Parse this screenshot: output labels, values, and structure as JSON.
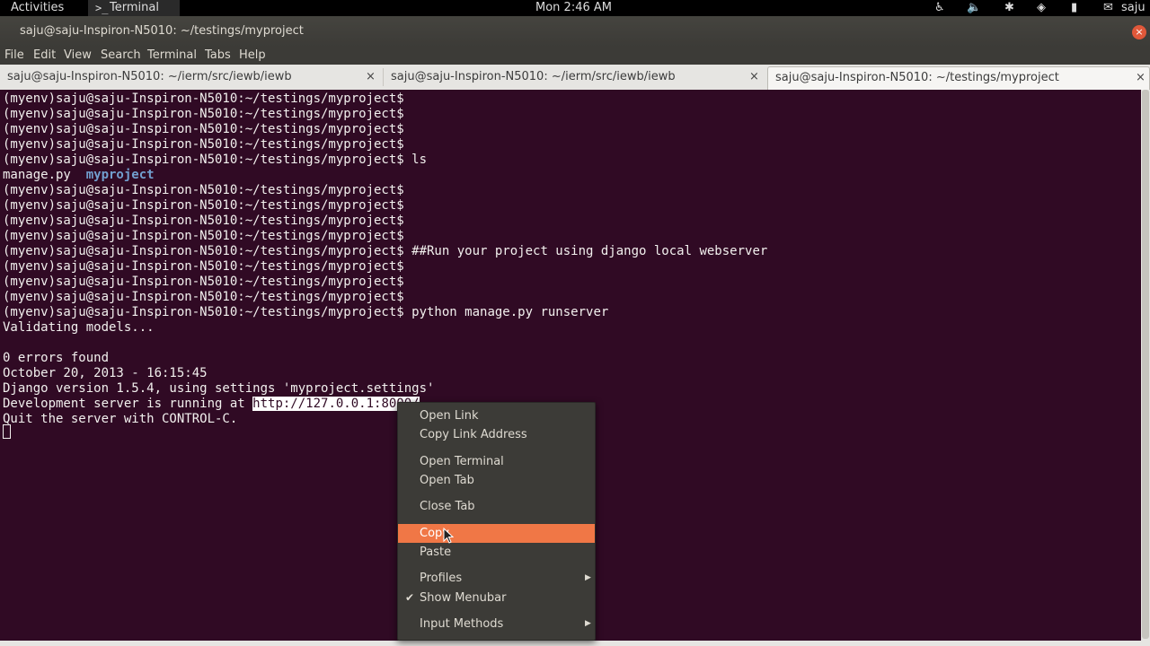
{
  "top_panel": {
    "activities": "Activities",
    "app_icon": ">_",
    "app_name": "Terminal",
    "clock": "Mon  2:46 AM",
    "tray_icons": [
      "accessibility-icon",
      "volume-icon",
      "bluetooth-icon",
      "wifi-icon",
      "battery-icon",
      "user-icon"
    ],
    "user": "saju"
  },
  "window": {
    "title": "saju@saju-Inspiron-N5010: ~/testings/myproject",
    "close_glyph": "×"
  },
  "menubar": [
    "File",
    "Edit",
    "View",
    "Search",
    "Terminal",
    "Tabs",
    "Help"
  ],
  "tabs": [
    {
      "label": "saju@saju-Inspiron-N5010: ~/ierm/src/iewb/iewb",
      "close": "×"
    },
    {
      "label": "saju@saju-Inspiron-N5010: ~/ierm/src/iewb/iewb",
      "close": "×"
    },
    {
      "label": "saju@saju-Inspiron-N5010: ~/testings/myproject",
      "close": "×"
    }
  ],
  "terminal": {
    "colors": {
      "background": "#300a24",
      "text": "#f2f0ee",
      "directory": "#729fcf"
    },
    "prompt": "(myenv)saju@saju-Inspiron-N5010:~/testings/myproject$",
    "lines": [
      "(myenv)saju@saju-Inspiron-N5010:~/testings/myproject$",
      "(myenv)saju@saju-Inspiron-N5010:~/testings/myproject$",
      "(myenv)saju@saju-Inspiron-N5010:~/testings/myproject$",
      "(myenv)saju@saju-Inspiron-N5010:~/testings/myproject$",
      "(myenv)saju@saju-Inspiron-N5010:~/testings/myproject$ ls",
      "LS_OUTPUT",
      "(myenv)saju@saju-Inspiron-N5010:~/testings/myproject$",
      "(myenv)saju@saju-Inspiron-N5010:~/testings/myproject$",
      "(myenv)saju@saju-Inspiron-N5010:~/testings/myproject$",
      "(myenv)saju@saju-Inspiron-N5010:~/testings/myproject$",
      "(myenv)saju@saju-Inspiron-N5010:~/testings/myproject$ ##Run your project using django local webserver",
      "(myenv)saju@saju-Inspiron-N5010:~/testings/myproject$",
      "(myenv)saju@saju-Inspiron-N5010:~/testings/myproject$",
      "(myenv)saju@saju-Inspiron-N5010:~/testings/myproject$",
      "(myenv)saju@saju-Inspiron-N5010:~/testings/myproject$ python manage.py runserver",
      "Validating models...",
      "",
      "0 errors found",
      "October 20, 2013 - 16:15:45",
      "Django version 1.5.4, using settings 'myproject.settings'",
      "SERVER_LINE",
      "Quit the server with CONTROL-C."
    ],
    "ls_file": "manage.py",
    "ls_dir": "myproject",
    "server_prefix": "Development server is running at ",
    "server_url": "http://127.0.0.1:8000/"
  },
  "context_menu": {
    "items": [
      {
        "label": "Open Link"
      },
      {
        "label": "Copy Link Address"
      },
      {
        "label": "Open Terminal"
      },
      {
        "label": "Open Tab"
      },
      {
        "label": "Close Tab"
      },
      {
        "label": "Copy",
        "highlighted": true
      },
      {
        "label": "Paste"
      },
      {
        "label": "Profiles",
        "submenu": true
      },
      {
        "label": "Show Menubar",
        "checked": true
      },
      {
        "label": "Input Methods",
        "submenu": true
      }
    ],
    "highlight_color": "#f07746",
    "check_glyph": "✔",
    "submenu_glyph": "▶"
  }
}
